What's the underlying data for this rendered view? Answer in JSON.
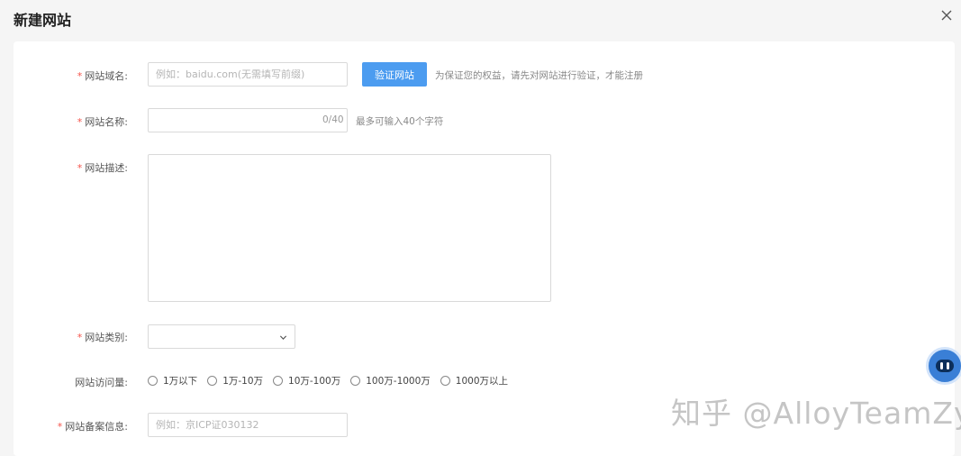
{
  "dialog": {
    "title": "新建网站"
  },
  "form": {
    "domain": {
      "label": "网站域名:",
      "placeholder": "例如：baidu.com(无需填写前缀)",
      "verify_button": "验证网站",
      "hint": "为保证您的权益，请先对网站进行验证，才能注册"
    },
    "name": {
      "label": "网站名称:",
      "counter": "0/40",
      "hint": "最多可输入40个字符"
    },
    "description": {
      "label": "网站描述:"
    },
    "category": {
      "label": "网站类别:",
      "selected": ""
    },
    "traffic": {
      "label": "网站访问量:",
      "options": [
        "1万以下",
        "1万-10万",
        "10万-100万",
        "100万-1000万",
        "1000万以上"
      ]
    },
    "icp": {
      "label": "网站备案信息:",
      "placeholder": "例如：京ICP证030132"
    }
  },
  "watermark": "知乎 @AlloyTeamZy",
  "icons": {
    "close": "close-icon",
    "chevron": "chevron-down-icon",
    "assistant": "robot-assistant-icon"
  },
  "colors": {
    "primary": "#4c9cf0",
    "required": "#f5534a"
  }
}
